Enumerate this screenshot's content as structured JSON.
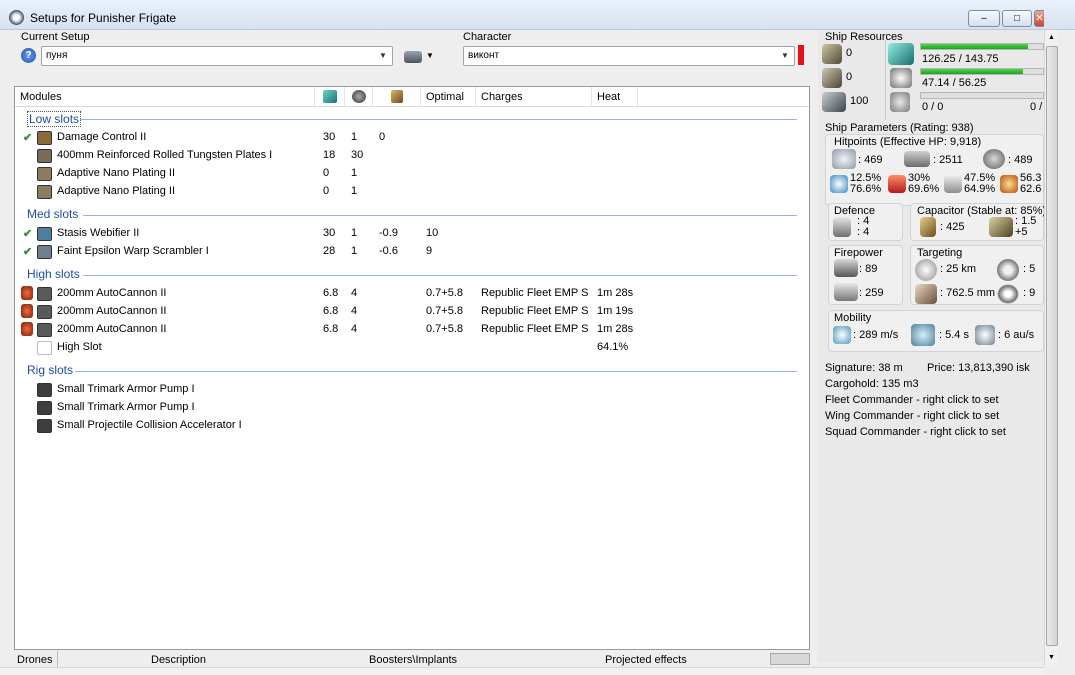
{
  "window": {
    "title": "Setups for Punisher Frigate",
    "min": "–",
    "max": "□",
    "close": "✕"
  },
  "setup": {
    "label": "Current Setup",
    "value": "пуня"
  },
  "character": {
    "label": "Character",
    "value": "виконт"
  },
  "columns": {
    "modules": "Modules",
    "optimal": "Optimal",
    "charges": "Charges",
    "heat": "Heat"
  },
  "sections": [
    {
      "title": "Low slots",
      "rows": [
        {
          "check": "✔",
          "name": "Damage Control II",
          "c1": "30",
          "c2": "1",
          "c3": "0",
          "optimal": "",
          "charges": "",
          "heat": "",
          "color": "#8a6a3b"
        },
        {
          "check": "",
          "name": "400mm Reinforced Rolled Tungsten Plates I",
          "c1": "18",
          "c2": "30",
          "c3": "",
          "optimal": "",
          "charges": "",
          "heat": "",
          "color": "#7c6a58"
        },
        {
          "check": "",
          "name": "Adaptive Nano Plating II",
          "c1": "0",
          "c2": "1",
          "c3": "",
          "optimal": "",
          "charges": "",
          "heat": "",
          "color": "#8d7b60"
        },
        {
          "check": "",
          "name": "Adaptive Nano Plating II",
          "c1": "0",
          "c2": "1",
          "c3": "",
          "optimal": "",
          "charges": "",
          "heat": "",
          "color": "#8d7b60"
        }
      ]
    },
    {
      "title": "Med slots",
      "rows": [
        {
          "check": "✔",
          "name": "Stasis Webifier II",
          "c1": "30",
          "c2": "1",
          "c3": "-0.9",
          "optimal": "10",
          "charges": "",
          "heat": "",
          "color": "#4d7f9c"
        },
        {
          "check": "✔",
          "name": "Faint Epsilon Warp Scrambler I",
          "c1": "28",
          "c2": "1",
          "c3": "-0.6",
          "optimal": "9",
          "charges": "",
          "heat": "",
          "color": "#6f7f8f"
        }
      ]
    },
    {
      "title": "High slots",
      "rows": [
        {
          "check": "",
          "name": "200mm AutoCannon II",
          "c1": "6.8",
          "c2": "4",
          "c3": "",
          "optimal": "0.7+5.8",
          "charges": "Republic Fleet EMP S",
          "heat": "1m 28s",
          "color": "#5a5a5a"
        },
        {
          "check": "",
          "name": "200mm AutoCannon II",
          "c1": "6.8",
          "c2": "4",
          "c3": "",
          "optimal": "0.7+5.8",
          "charges": "Republic Fleet EMP S",
          "heat": "1m 19s",
          "color": "#5a5a5a"
        },
        {
          "check": "",
          "name": "200mm AutoCannon II",
          "c1": "6.8",
          "c2": "4",
          "c3": "",
          "optimal": "0.7+5.8",
          "charges": "Republic Fleet EMP S",
          "heat": "1m 28s",
          "color": "#5a5a5a"
        },
        {
          "check": "",
          "name": "High Slot",
          "c1": "",
          "c2": "",
          "c3": "",
          "optimal": "",
          "charges": "",
          "heat": "64.1%",
          "color": "#ffffff"
        }
      ]
    },
    {
      "title": "Rig slots",
      "rows": [
        {
          "check": "",
          "name": "Small Trimark Armor Pump I",
          "c1": "",
          "c2": "",
          "c3": "",
          "optimal": "",
          "charges": "",
          "heat": "",
          "color": "#3d3d3d"
        },
        {
          "check": "",
          "name": "Small Trimark Armor Pump I",
          "c1": "",
          "c2": "",
          "c3": "",
          "optimal": "",
          "charges": "",
          "heat": "",
          "color": "#3d3d3d"
        },
        {
          "check": "",
          "name": "Small Projectile Collision Accelerator I",
          "c1": "",
          "c2": "",
          "c3": "",
          "optimal": "",
          "charges": "",
          "heat": "",
          "color": "#3d3d3d"
        }
      ]
    }
  ],
  "bottom_tabs": {
    "drones": "Drones",
    "description": "Description",
    "boosters": "Boosters\\Implants",
    "projected": "Projected effects"
  },
  "resources": {
    "label": "Ship Resources",
    "turrets": "0",
    "launchers": "0",
    "calibration": "100",
    "cpu": "126.25 / 143.75",
    "cpu_fraction": 0.878,
    "power": "47.14 / 56.25",
    "power_fraction": 0.838,
    "drone": "0 / 0",
    "drone_right": "0 /"
  },
  "parameters": {
    "label": "Ship Parameters (Rating: 938)",
    "hitpoints": "Hitpoints (Effective HP: 9,918)",
    "shield_hp": ": 469",
    "armor_hp": ": 2511",
    "hull_hp": ": 489",
    "res_em": "12.5%",
    "res_em2": "76.6%",
    "res_th": "30%",
    "res_th2": "69.6%",
    "res_ki": "47.5%",
    "res_ki2": "64.9%",
    "res_ex": "56.3",
    "res_ex2": "62.6",
    "defence": "Defence",
    "def1": ": 4",
    "def2": ": 4",
    "capacitor": "Capacitor (Stable at: 85%)",
    "cap_amount": ": 425",
    "cap_recharge": ": 1.5",
    "cap_delta": "+5",
    "firepower": "Firepower",
    "dps": ": 89",
    "volley": ": 259",
    "targeting": "Targeting",
    "range": ": 25 km",
    "targets": ": 5",
    "resolution": ": 762.5 mm",
    "scan": ": 9",
    "mobility": "Mobility",
    "speed": ": 289 m/s",
    "align": ": 5.4 s",
    "warp": ": 6 au/s",
    "signature": "Signature: 38 m",
    "price": "Price: 13,813,390 isk",
    "cargo": "Cargohold: 135 m3",
    "fleet": "Fleet Commander - right click to set",
    "wing": "Wing Commander - right click to set",
    "squad": "Squad Commander - right click to set"
  }
}
